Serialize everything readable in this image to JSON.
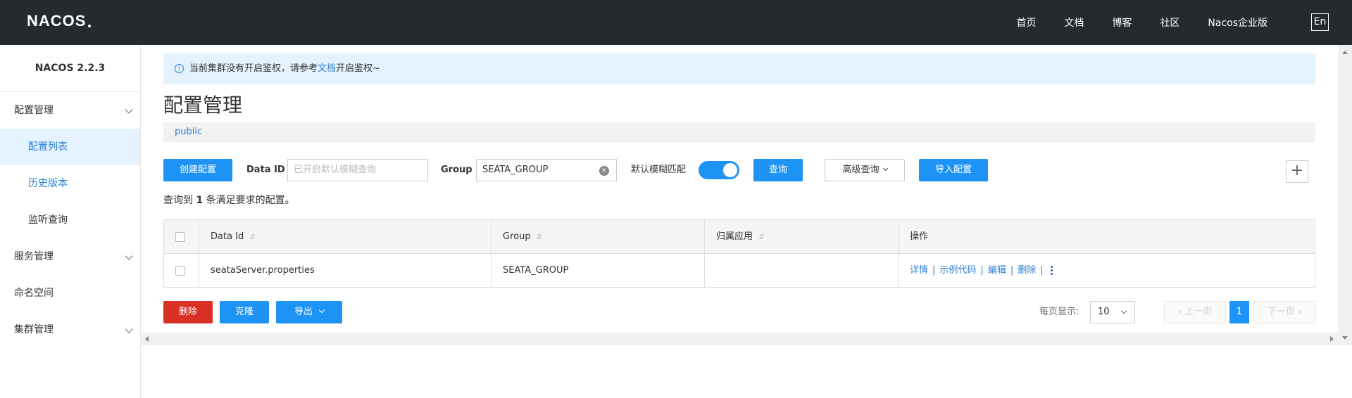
{
  "header": {
    "logo_text": "NACOS",
    "nav": [
      "首页",
      "文档",
      "博客",
      "社区",
      "Nacos企业版"
    ],
    "lang_button": "En"
  },
  "sidebar": {
    "version": "NACOS 2.2.3",
    "items": [
      {
        "label": "配置管理",
        "type": "group"
      },
      {
        "label": "配置列表",
        "type": "sub",
        "active": true
      },
      {
        "label": "历史版本",
        "type": "sub"
      },
      {
        "label": "监听查询",
        "type": "sub"
      },
      {
        "label": "服务管理",
        "type": "group"
      },
      {
        "label": "命名空间",
        "type": "item"
      },
      {
        "label": "集群管理",
        "type": "group"
      }
    ]
  },
  "notice": {
    "icon": "info-icon",
    "text_before": "当前集群没有开启鉴权，请参考",
    "link": "文档",
    "text_after": "开启鉴权~"
  },
  "page_title": "配置管理",
  "namespace": "public",
  "toolbar": {
    "create_button": "创建配置",
    "dataid_label": "Data ID",
    "dataid_placeholder": "已开启默认模糊查询",
    "group_label": "Group",
    "group_value": "SEATA_GROUP",
    "fuzzy_label": "默认模糊匹配",
    "fuzzy_on": true,
    "search_button": "查询",
    "advanced_button": "高级查询",
    "import_button": "导入配置",
    "add_icon": "plus-icon"
  },
  "result": {
    "prefix": "查询到",
    "count": "1",
    "suffix": "条满足要求的配置。"
  },
  "table": {
    "columns": [
      "Data Id",
      "Group",
      "归属应用",
      "操作"
    ],
    "rows": [
      {
        "data_id": "seataServer.properties",
        "group": "SEATA_GROUP",
        "app": "",
        "ops": [
          "详情",
          "示例代码",
          "编辑",
          "删除"
        ]
      }
    ]
  },
  "bottom": {
    "delete_button": "删除",
    "clone_button": "克隆",
    "export_button": "导出",
    "page_size_label": "每页显示:",
    "page_size": "10",
    "prev": "上一页",
    "current_page": "1",
    "next": "下一页"
  },
  "colors": {
    "accent": "#1e93f6",
    "danger": "#d93026",
    "topbar": "#252a2f",
    "link": "#2b7ed6"
  }
}
